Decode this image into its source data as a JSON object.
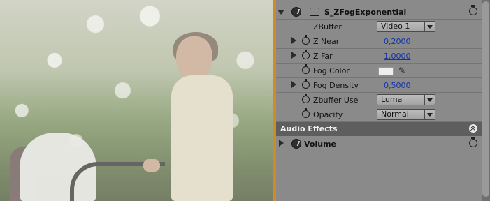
{
  "preview": {
    "description_name": "video-preview"
  },
  "effect": {
    "name": "S_ZFogExponential",
    "rows": [
      {
        "key": "zbuffer",
        "label": "ZBuffer",
        "kind": "dropdown",
        "value": "Video 1",
        "expandable": false,
        "stopwatch": false
      },
      {
        "key": "znear",
        "label": "Z Near",
        "kind": "number",
        "value": "0,2000",
        "expandable": true,
        "stopwatch": true
      },
      {
        "key": "zfar",
        "label": "Z Far",
        "kind": "number",
        "value": "1,0000",
        "expandable": true,
        "stopwatch": true
      },
      {
        "key": "fogcolor",
        "label": "Fog Color",
        "kind": "color",
        "value": "#eeeeee",
        "expandable": false,
        "stopwatch": true
      },
      {
        "key": "fogdensity",
        "label": "Fog Density",
        "kind": "number",
        "value": "0,5000",
        "expandable": true,
        "stopwatch": true
      },
      {
        "key": "zbufferuse",
        "label": "Zbuffer Use",
        "kind": "dropdown",
        "value": "Luma",
        "expandable": false,
        "stopwatch": true
      },
      {
        "key": "opacity",
        "label": "Opacity",
        "kind": "dropdown",
        "value": "Normal",
        "expandable": false,
        "stopwatch": true
      }
    ]
  },
  "audio_section": {
    "title": "Audio Effects",
    "effect_name": "Volume"
  },
  "colors": {
    "accent_orange": "#d08a2a",
    "value_blue": "#1133aa",
    "section_header": "#5e5e5e",
    "panel_bg": "#8a8a8a"
  }
}
